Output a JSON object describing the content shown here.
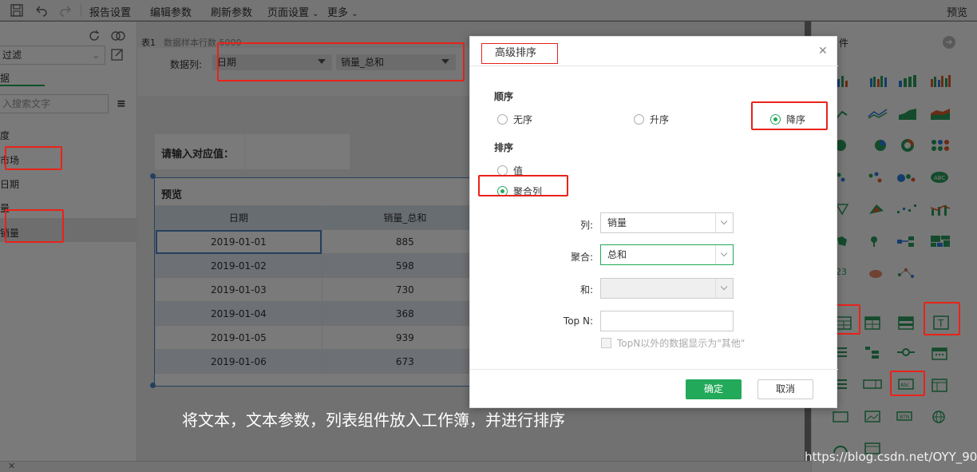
{
  "toolbar": {
    "items": [
      "报告设置",
      "编辑参数",
      "刷新参数",
      "页面设置",
      "更多"
    ],
    "preview": "预览"
  },
  "left_panel": {
    "filter_value": "过滤",
    "tab_label": "据",
    "search_placeholder": "入搜索文字",
    "items": [
      "度",
      "市场",
      "日期",
      "量",
      "销量"
    ]
  },
  "center": {
    "table_label": "表1",
    "sample_text": "数据样本行数 5000",
    "data_column_label": "数据列:",
    "dropdown_date": "日期",
    "dropdown_sales": "销量_总和",
    "input_prompt": "请输入对应值：",
    "preview_title": "预览",
    "table_headers": [
      "日期",
      "销量_总和"
    ],
    "table_rows": [
      [
        "2019-01-01",
        "885"
      ],
      [
        "2019-01-02",
        "598"
      ],
      [
        "2019-01-03",
        "730"
      ],
      [
        "2019-01-04",
        "368"
      ],
      [
        "2019-01-05",
        "939"
      ],
      [
        "2019-01-06",
        "673"
      ]
    ],
    "caption": "将文本，文本参数，列表组件放入工作簿，并进行排序"
  },
  "right_panel": {
    "title": "件",
    "watermark": "https://blog.csdn.net/OYY_90"
  },
  "dialog": {
    "title": "高级排序",
    "order_section": "顺序",
    "order_options": [
      "无序",
      "升序",
      "降序"
    ],
    "selected_order": "降序",
    "sort_section": "排序",
    "sort_options": [
      "值",
      "聚合列"
    ],
    "selected_sort": "聚合列",
    "column_label": "列:",
    "column_value": "销量",
    "aggregate_label": "聚合:",
    "aggregate_value": "总和",
    "and_label": "和:",
    "and_value": "",
    "topn_label": "Top N:",
    "topn_value": "",
    "topn_checkbox": "TopN以外的数据显示为\"其他\"",
    "ok_button": "确定",
    "cancel_button": "取消"
  },
  "colors": {
    "accent_green": "#23a95a",
    "highlight_red": "#e8231a",
    "preview_blue": "#4f86c6"
  }
}
